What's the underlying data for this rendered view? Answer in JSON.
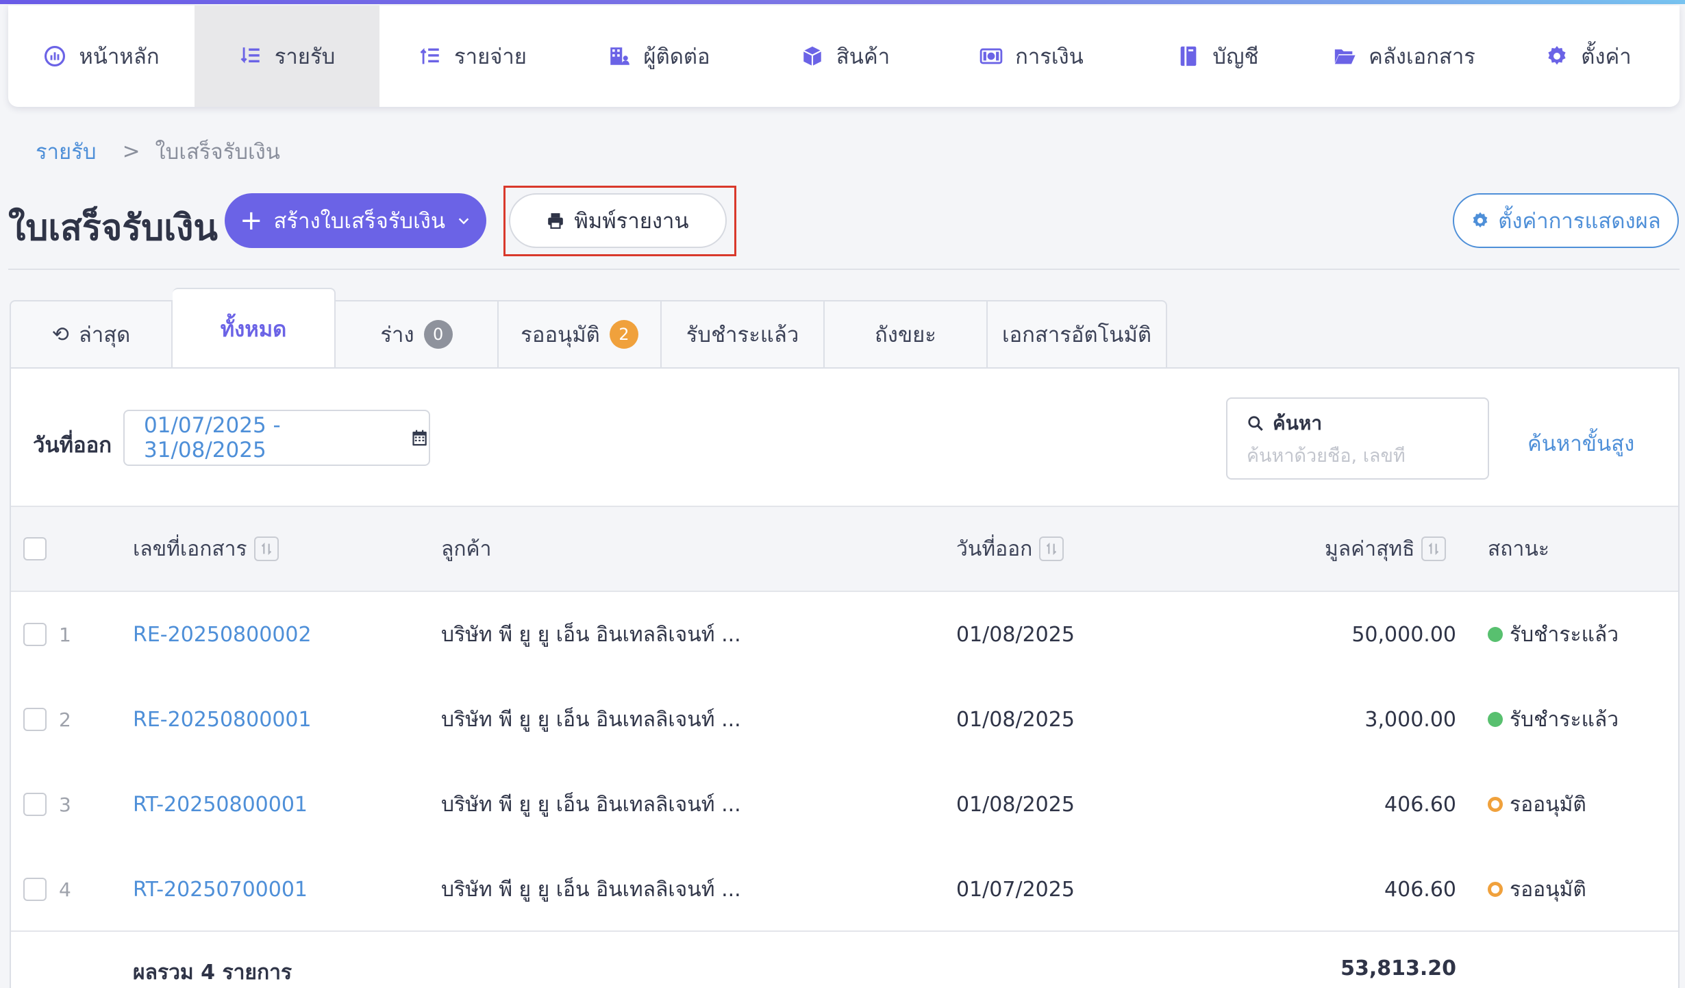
{
  "nav": {
    "items": [
      {
        "label": "หน้าหลัก",
        "icon": "dashboard-gauge-icon"
      },
      {
        "label": "รายรับ",
        "icon": "income-sort-icon"
      },
      {
        "label": "รายจ่าย",
        "icon": "expense-sort-icon"
      },
      {
        "label": "ผู้ติดต่อ",
        "icon": "contacts-building-icon"
      },
      {
        "label": "สินค้า",
        "icon": "product-box-icon"
      },
      {
        "label": "การเงิน",
        "icon": "money-bill-icon"
      },
      {
        "label": "บัญชี",
        "icon": "ledger-book-icon"
      },
      {
        "label": "คลังเอกสาร",
        "icon": "folder-open-icon"
      },
      {
        "label": "ตั้งค่า",
        "icon": "gear-icon"
      }
    ],
    "active_index": 1
  },
  "breadcrumb": {
    "parent": "รายรับ",
    "separator": ">",
    "current": "ใบเสร็จรับเงิน"
  },
  "header": {
    "title": "ใบเสร็จรับเงิน",
    "create_label": "สร้างใบเสร็จรับเงิน",
    "print_label": "พิมพ์รายงาน",
    "display_settings_label": "ตั้งค่าการแสดงผล"
  },
  "tabs": [
    {
      "label": "ล่าสุด",
      "icon": "history-icon"
    },
    {
      "label": "ทั้งหมด",
      "active": true
    },
    {
      "label": "ร่าง",
      "badge": "0"
    },
    {
      "label": "รออนุมัติ",
      "badge": "2"
    },
    {
      "label": "รับชำระแล้ว"
    },
    {
      "label": "ถังขยะ"
    },
    {
      "label": "เอกสารอัตโนมัติ"
    }
  ],
  "filters": {
    "date_label": "วันที่ออก",
    "date_range": "01/07/2025 - 31/08/2025",
    "search_label": "ค้นหา",
    "search_placeholder": "ค้นหาด้วยชื่อ, เลขที่",
    "advanced_label": "ค้นหาขั้นสูง"
  },
  "table": {
    "columns": {
      "doc_no": "เลขที่เอกสาร",
      "customer": "ลูกค้า",
      "date": "วันที่ออก",
      "net": "มูลค่าสุทธิ",
      "status": "สถานะ"
    },
    "rows": [
      {
        "num": "1",
        "doc_no": "RE-20250800002",
        "customer": "บริษัท พี ยู ยู เอ็น อินเทลลิเจนท์ ...",
        "date": "01/08/2025",
        "net": "50,000.00",
        "status": "รับชำระแล้ว",
        "status_color": "#58c06f"
      },
      {
        "num": "2",
        "doc_no": "RE-20250800001",
        "customer": "บริษัท พี ยู ยู เอ็น อินเทลลิเจนท์ ...",
        "date": "01/08/2025",
        "net": "3,000.00",
        "status": "รับชำระแล้ว",
        "status_color": "#58c06f"
      },
      {
        "num": "3",
        "doc_no": "RT-20250800001",
        "customer": "บริษัท พี ยู ยู เอ็น อินเทลลิเจนท์ ...",
        "date": "01/08/2025",
        "net": "406.60",
        "status": "รออนุมัติ",
        "status_color": "#f0a13c"
      },
      {
        "num": "4",
        "doc_no": "RT-20250700001",
        "customer": "บริษัท พี ยู ยู เอ็น อินเทลลิเจนท์ ...",
        "date": "01/07/2025",
        "net": "406.60",
        "status": "รออนุมัติ",
        "status_color": "#f0a13c"
      }
    ],
    "footer": {
      "label": "ผลรวม 4 รายการ",
      "total": "53,813.20"
    }
  },
  "colors": {
    "primary": "#6b63e6",
    "link": "#4e8fd8",
    "highlight": "#d9392c"
  }
}
